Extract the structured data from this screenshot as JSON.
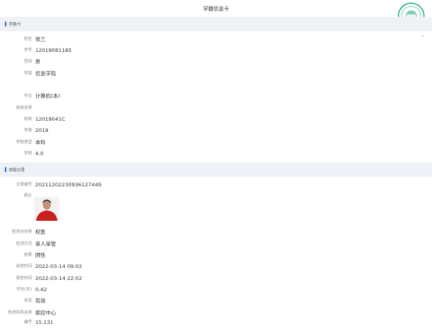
{
  "header": {
    "title": "学籍信息卡"
  },
  "section1": {
    "title": "学籍卡",
    "rows": [
      {
        "label": "姓名",
        "value": "张三"
      },
      {
        "label": "学号",
        "value": "12019081185"
      },
      {
        "label": "性别",
        "value": "男"
      },
      {
        "label": "学院",
        "value": "信息学院"
      },
      {
        "label": "",
        "value": ""
      },
      {
        "label": "专业",
        "value": "计算机(本)"
      },
      {
        "label": "班级名称",
        "value": ""
      },
      {
        "label": "班级",
        "value": "12019041C"
      },
      {
        "label": "年级",
        "value": "2019"
      },
      {
        "label": "学制类型",
        "value": "本科"
      },
      {
        "label": "学制",
        "value": "4.0"
      }
    ]
  },
  "section2": {
    "title": "核酸记录",
    "rows": [
      {
        "label": "记录编号",
        "value": "20211202230936127449"
      },
      {
        "label": "照片",
        "value": ""
      },
      {
        "label": "检测点名称",
        "value": "校医"
      },
      {
        "label": "检测方式",
        "value": "单人单管"
      },
      {
        "label": "结果",
        "value": "阴性"
      },
      {
        "label": "采样时间",
        "value": "2022-03-14 09:02"
      },
      {
        "label": "报告时间",
        "value": "2022-03-14 22:02"
      },
      {
        "label": "时长(天)",
        "value": "0.42"
      },
      {
        "label": "状态",
        "value": "有效"
      },
      {
        "label": "检测机构名称",
        "value": "疾控中心"
      },
      {
        "label": "编号",
        "value": "15.131"
      }
    ]
  },
  "colors": {
    "accent": "#3a7bd5",
    "section_bg": "#eef1f5",
    "stamp": "#1aa37a"
  },
  "icons": {
    "collapse": "chevron-up-icon",
    "stamp": "official-seal-icon"
  }
}
